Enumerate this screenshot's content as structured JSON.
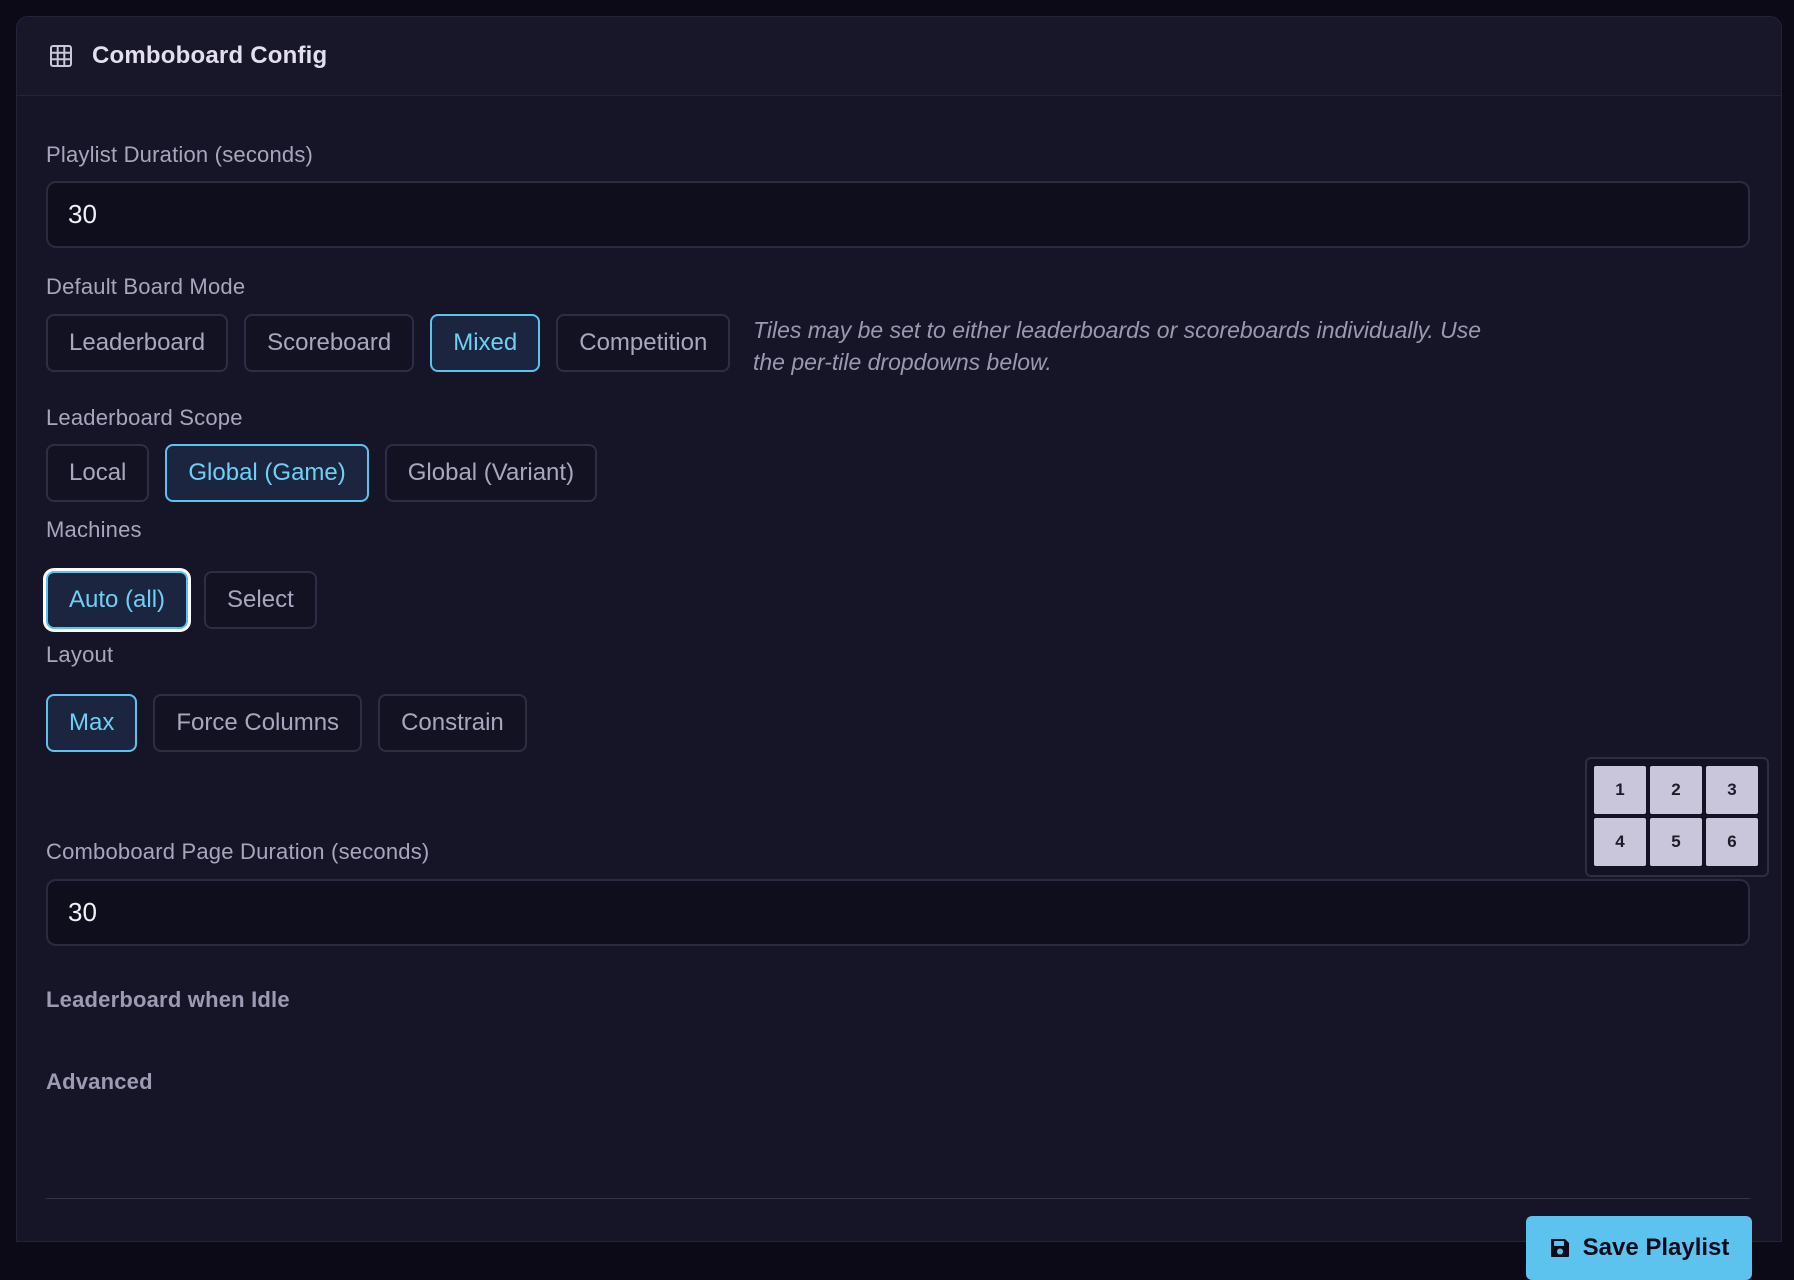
{
  "header": {
    "title": "Comboboard Config",
    "icon": "grid-icon"
  },
  "playlist_duration": {
    "label": "Playlist Duration (seconds)",
    "value": "30"
  },
  "board_mode": {
    "label": "Default Board Mode",
    "options": [
      "Leaderboard",
      "Scoreboard",
      "Mixed",
      "Competition"
    ],
    "selected": "Mixed",
    "hint": "Tiles may be set to either leaderboards or scoreboards individually. Use the per-tile dropdowns below."
  },
  "leaderboard_scope": {
    "label": "Leaderboard Scope",
    "options": [
      "Local",
      "Global (Game)",
      "Global (Variant)"
    ],
    "selected": "Global (Game)"
  },
  "machines": {
    "label": "Machines",
    "options": [
      "Auto (all)",
      "Select"
    ],
    "selected": "Auto (all)"
  },
  "layout": {
    "label": "Layout",
    "options": [
      "Max",
      "Force Columns",
      "Constrain"
    ],
    "selected": "Max",
    "tiles": [
      "1",
      "2",
      "3",
      "4",
      "5",
      "6"
    ]
  },
  "page_duration": {
    "label": "Comboboard Page Duration (seconds)",
    "value": "30"
  },
  "sections": {
    "idle": "Leaderboard when Idle",
    "advanced": "Advanced"
  },
  "footer": {
    "save_label": "Save Playlist",
    "save_icon": "floppy-disk-icon"
  },
  "colors": {
    "accent": "#5cc3ef",
    "panel_bg": "#161527",
    "page_bg": "#0b0a16"
  }
}
